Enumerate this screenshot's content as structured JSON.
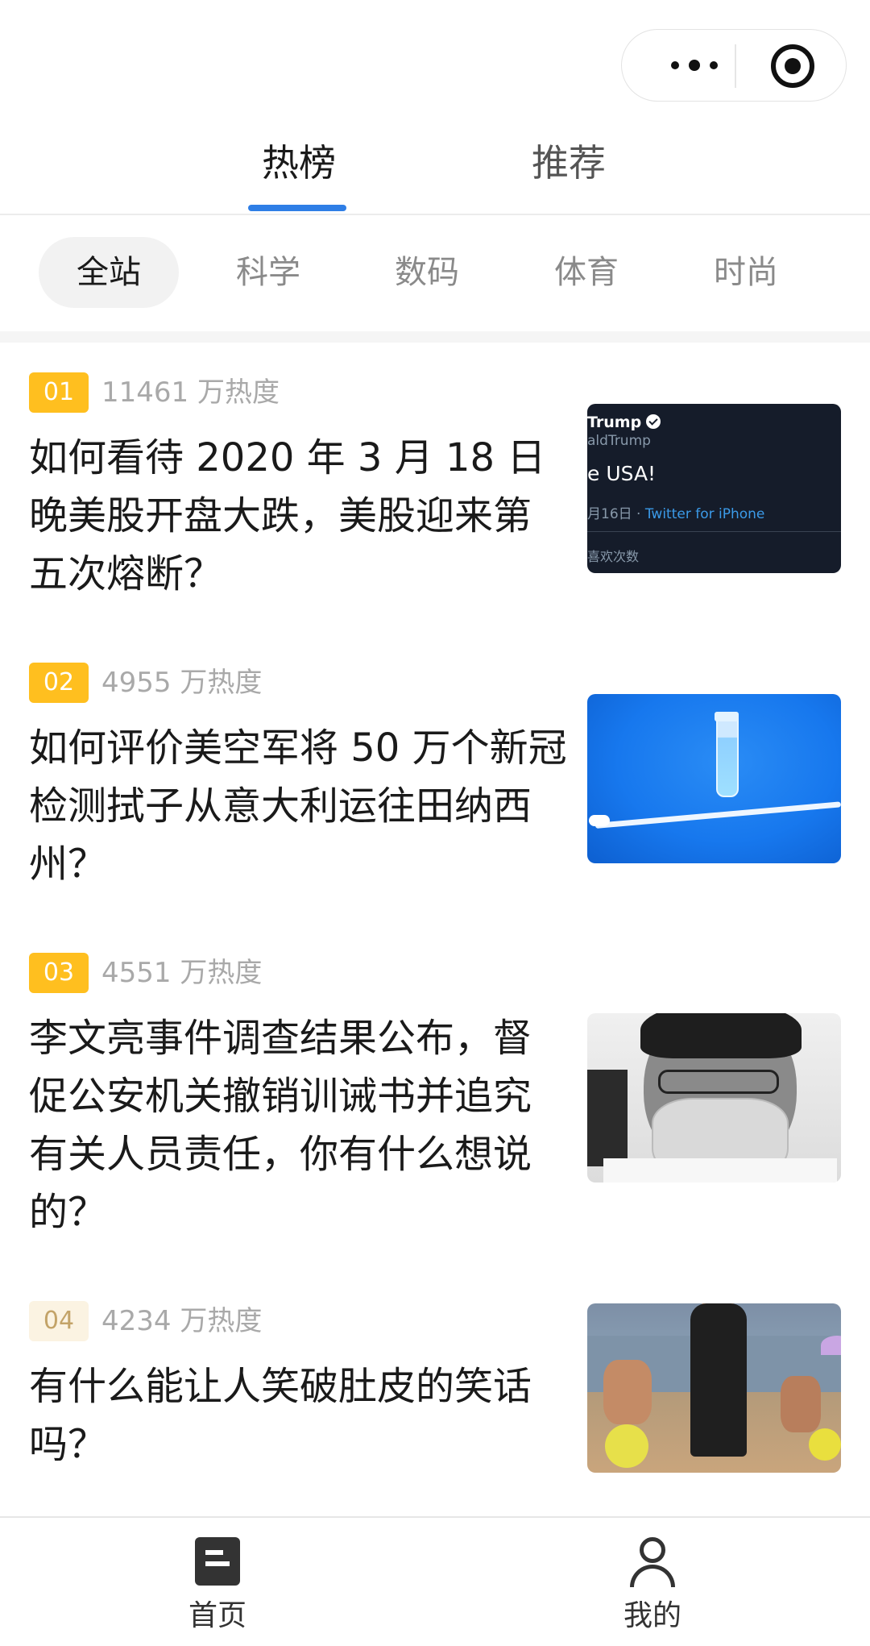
{
  "tabs": {
    "hot": "热榜",
    "recommend": "推荐"
  },
  "categories": [
    "全站",
    "科学",
    "数码",
    "体育",
    "时尚"
  ],
  "items": [
    {
      "rank": "01",
      "heat": "11461 万热度",
      "title": "如何看待 2020 年 3 月 18 日晚美股开盘大跌，美股迎来第五次熔断？",
      "thumb": {
        "name": "Trump",
        "handle": "aldTrump",
        "text": "e USA!",
        "date": "月16日 · ",
        "source": "Twitter for iPhone",
        "likes": "喜欢次数"
      }
    },
    {
      "rank": "02",
      "heat": "4955 万热度",
      "title": "如何评价美空军将 50 万个新冠检测拭子从意大利运往田纳西州？"
    },
    {
      "rank": "03",
      "heat": "4551 万热度",
      "title": "李文亮事件调查结果公布，督促公安机关撤销训诫书并追究有关人员责任，你有什么想说的？"
    },
    {
      "rank": "04",
      "heat": "4234 万热度",
      "title": "有什么能让人笑破肚皮的笑话吗？"
    }
  ],
  "bottom_nav": {
    "home": "首页",
    "mine": "我的"
  },
  "colors": {
    "accent": "#2e7ee6",
    "rank_gold": "#ffbf1f",
    "rank_pale": "#fbf3e2"
  }
}
